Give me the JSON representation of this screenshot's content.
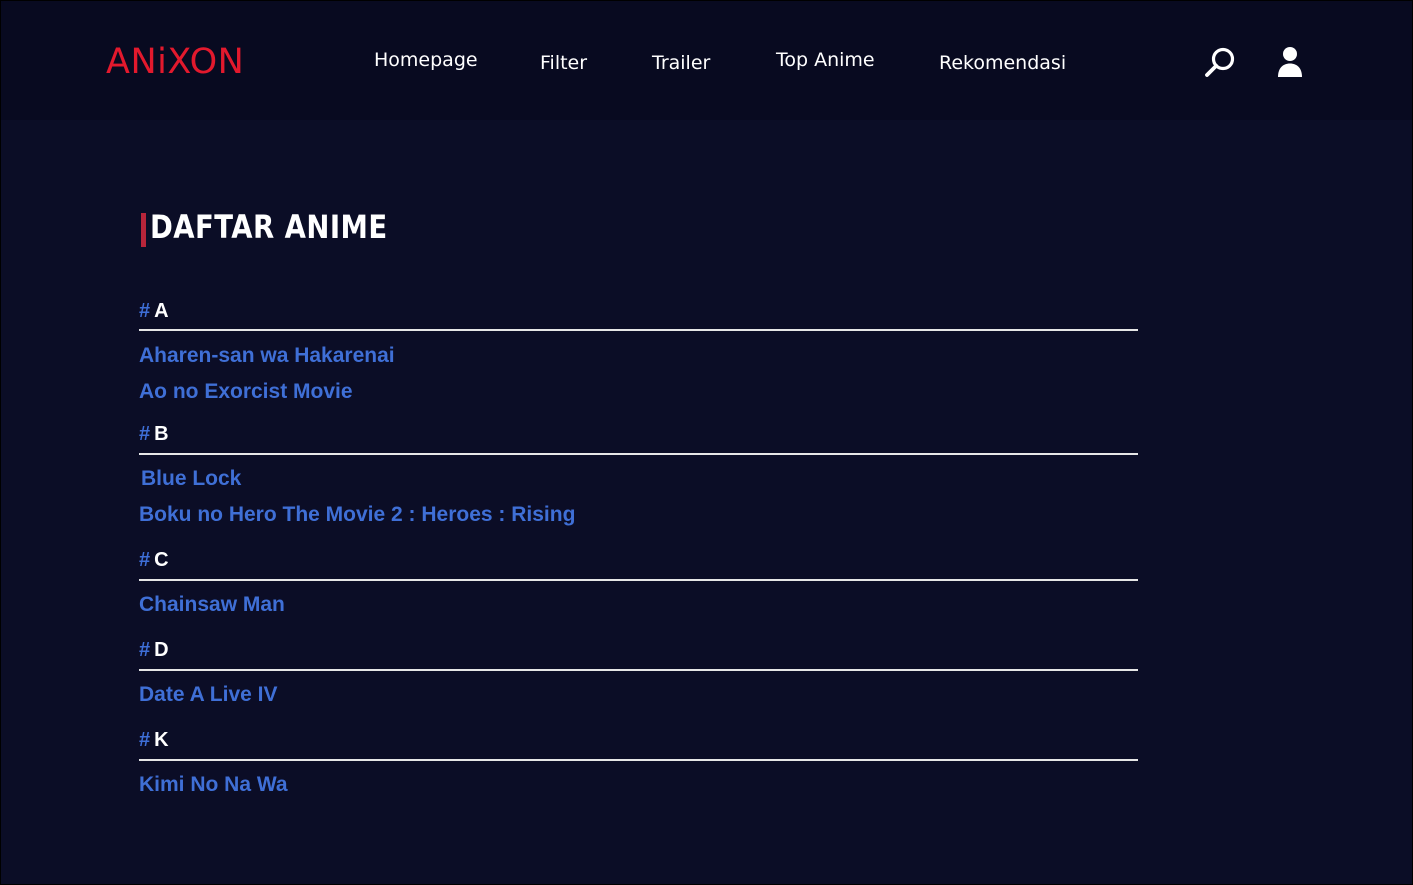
{
  "brand": {
    "logo_text": "ANiXON",
    "accent_color": "#e3192d"
  },
  "nav": {
    "items": [
      {
        "label": "Homepage"
      },
      {
        "label": "Filter"
      },
      {
        "label": "Trailer"
      },
      {
        "label": "Top Anime"
      },
      {
        "label": "Rekomendasi"
      }
    ],
    "icons": [
      "search-icon",
      "user-icon"
    ]
  },
  "page": {
    "title": "DAFTAR ANIME",
    "title_accent_color": "#b8253a",
    "link_color": "#3f6fd6",
    "background_color": "#0b0d26"
  },
  "sections": [
    {
      "hash": "#",
      "letter": "A",
      "items": [
        "Aharen-san wa Hakarenai",
        "Ao no Exorcist Movie"
      ]
    },
    {
      "hash": "#",
      "letter": "B",
      "items": [
        "Blue Lock",
        "Boku no Hero The Movie 2 : Heroes : Rising"
      ]
    },
    {
      "hash": "#",
      "letter": "C",
      "items": [
        "Chainsaw Man"
      ]
    },
    {
      "hash": "#",
      "letter": "D",
      "items": [
        "Date A Live IV"
      ]
    },
    {
      "hash": "#",
      "letter": "K",
      "items": [
        "Kimi No Na Wa"
      ]
    }
  ]
}
